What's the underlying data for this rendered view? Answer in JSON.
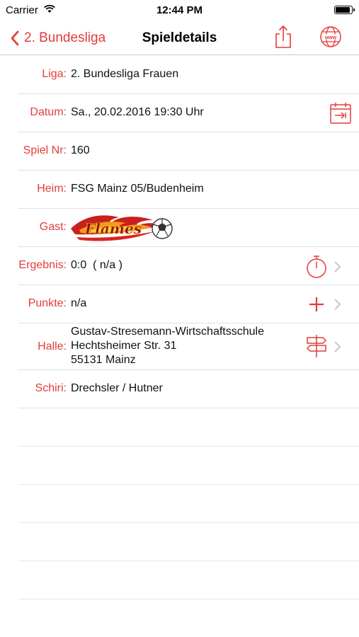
{
  "status_bar": {
    "carrier": "Carrier",
    "time": "12:44 PM"
  },
  "nav": {
    "back_label": "2. Bundesliga",
    "title": "Spieldetails"
  },
  "rows": {
    "liga": {
      "label": "Liga:",
      "value": "2. Bundesliga Frauen"
    },
    "datum": {
      "label": "Datum:",
      "value": "Sa., 20.02.2016 19:30 Uhr"
    },
    "spiel_nr": {
      "label": "Spiel Nr:",
      "value": "160"
    },
    "heim": {
      "label": "Heim:",
      "value": "FSG Mainz 05/Budenheim"
    },
    "gast": {
      "label": "Gast:",
      "logo_text": "Flames"
    },
    "ergebnis": {
      "label": "Ergebnis:",
      "value": "0:0  ( n/a )"
    },
    "punkte": {
      "label": "Punkte:",
      "value": "n/a"
    },
    "halle": {
      "label": "Halle:",
      "lines": [
        "Gustav-Stresemann-Wirtschaftsschule",
        "Hechtsheimer Str. 31",
        "55131 Mainz"
      ]
    },
    "schiri": {
      "label": "Schiri:",
      "value": "Drechsler / Hutner"
    }
  },
  "icons": {
    "back": "chevron-left-icon",
    "share": "share-icon",
    "website": "globe-icon",
    "calendar": "calendar-add-icon",
    "stopwatch": "stopwatch-icon",
    "plus": "plus-icon",
    "signpost": "signpost-icon",
    "disclosure": "chevron-right-icon"
  },
  "colors": {
    "accent": "#e43b3b",
    "separator": "#e0e0e4",
    "chevron": "#c7c7cc"
  }
}
